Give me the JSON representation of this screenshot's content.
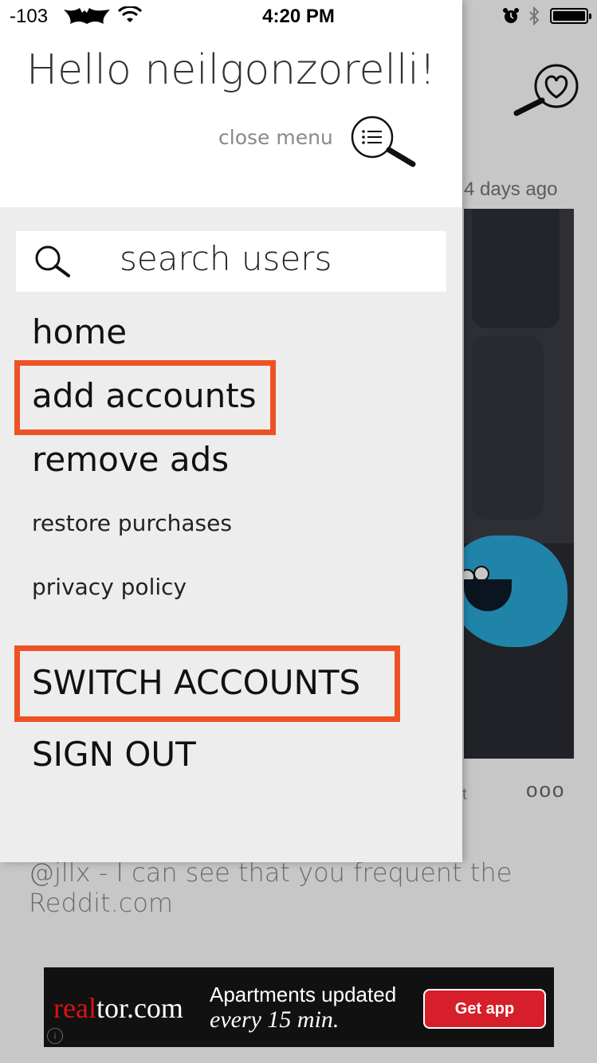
{
  "status_bar": {
    "carrier": "-103",
    "time": "4:20 PM"
  },
  "drawer": {
    "greeting": "Hello neilgonzorelli!",
    "close_menu_label": "close menu",
    "search_placeholder": "search users",
    "menu_items": [
      {
        "label": "home"
      },
      {
        "label": "add accounts"
      },
      {
        "label": "remove ads"
      },
      {
        "label": "restore purchases"
      },
      {
        "label": "privacy policy"
      },
      {
        "label": "SWITCH ACCOUNTS"
      },
      {
        "label": "SIGN OUT"
      }
    ],
    "highlight_color": "#ee5224"
  },
  "background_feed": {
    "timestamp": "4 days ago",
    "partial_text": "t",
    "more_dots": "ooo",
    "comment": "@jllx - I can see that you frequent the Reddit.com"
  },
  "ad": {
    "brand_red": "real",
    "brand_rest": "tor.com",
    "line1": "Apartments updated",
    "line2": "every 15 min.",
    "button": "Get app",
    "info": "i"
  }
}
